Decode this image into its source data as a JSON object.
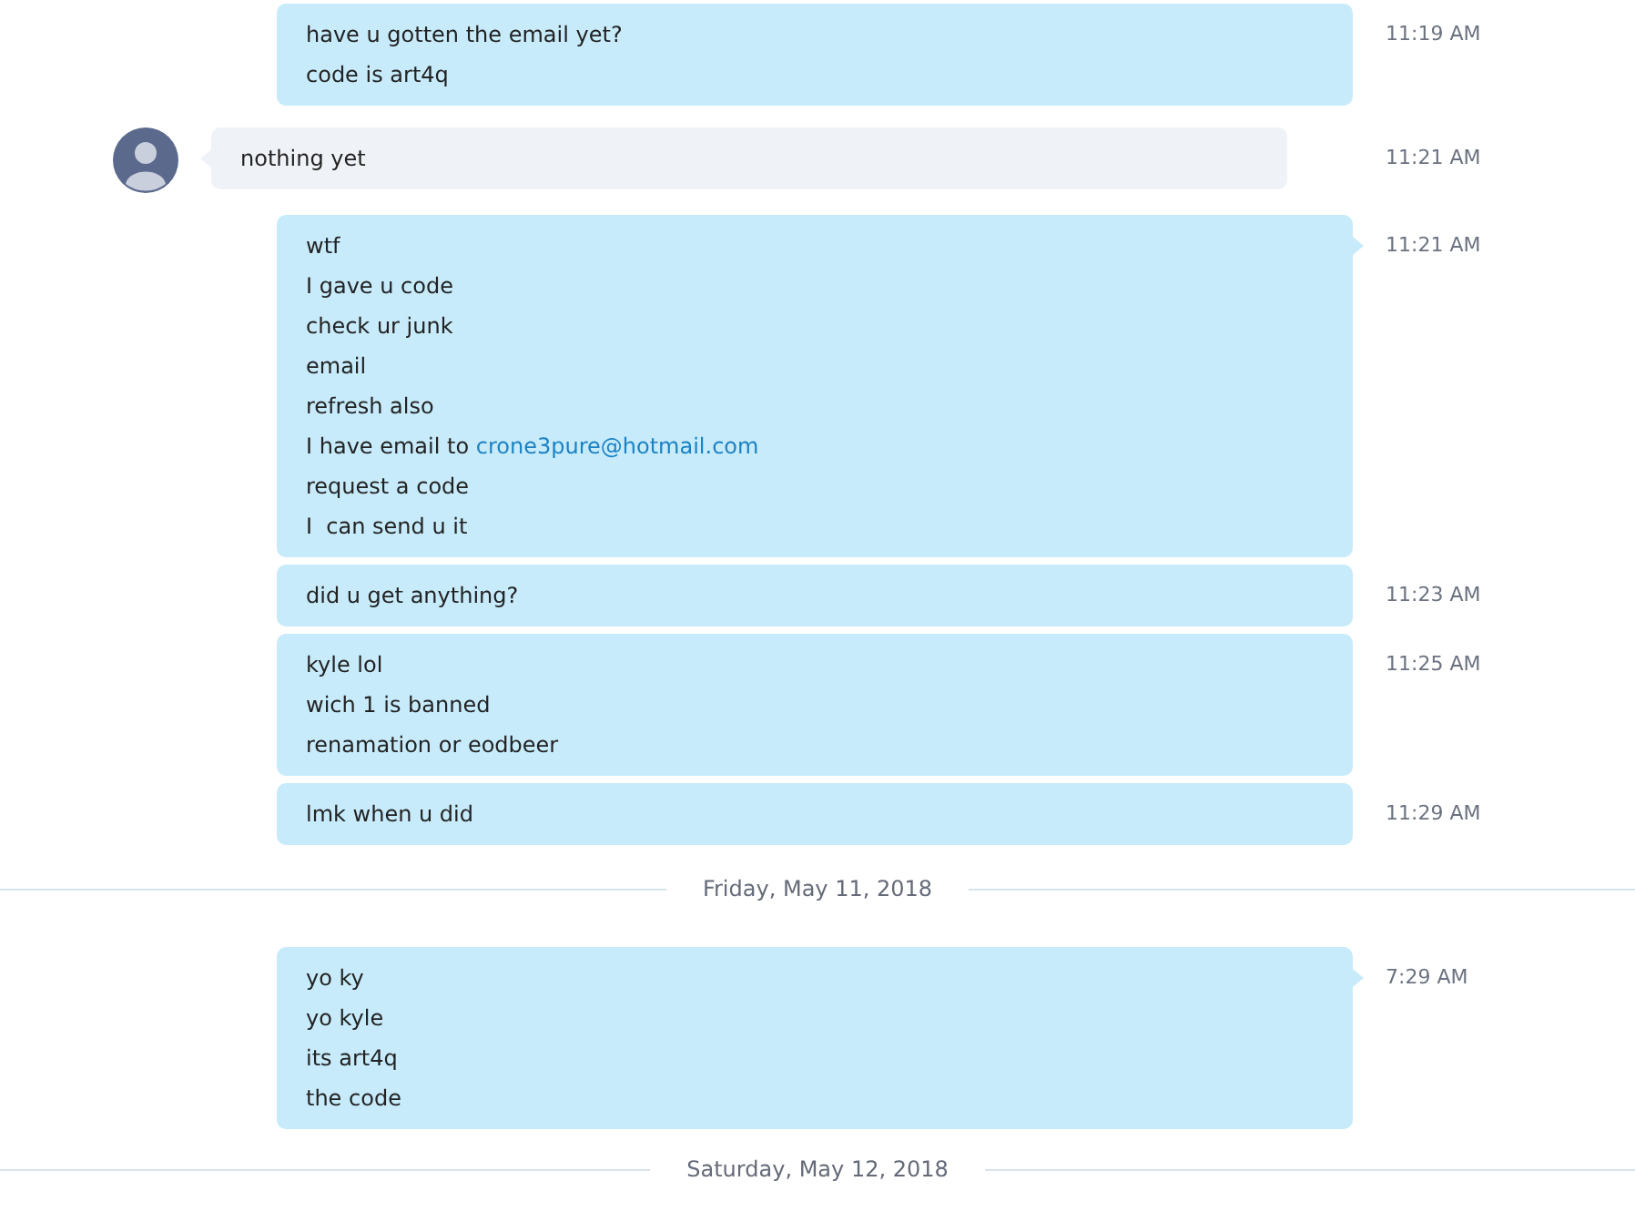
{
  "messages": [
    {
      "kind": "sent",
      "tail": false,
      "time": "11:19 AM",
      "lines": [
        {
          "text": "have u gotten the email yet?"
        },
        {
          "text": "code is art4q"
        }
      ]
    },
    {
      "kind": "received",
      "tail": true,
      "time": "11:21 AM",
      "lines": [
        {
          "text": "nothing yet"
        }
      ]
    },
    {
      "kind": "sent",
      "tail": true,
      "time": "11:21 AM",
      "lines": [
        {
          "text": "wtf"
        },
        {
          "text": "I gave u code"
        },
        {
          "text": "check ur junk"
        },
        {
          "text": "email"
        },
        {
          "text": "refresh also"
        },
        {
          "text": "I have email to ",
          "link": "crone3pure@hotmail.com"
        },
        {
          "text": "request a code"
        },
        {
          "text": "I  can send u it"
        }
      ]
    },
    {
      "kind": "sent",
      "tail": false,
      "time": "11:23 AM",
      "lines": [
        {
          "text": "did u get anything?"
        }
      ]
    },
    {
      "kind": "sent",
      "tail": false,
      "time": "11:25 AM",
      "lines": [
        {
          "text": "kyle lol"
        },
        {
          "text": "wich 1 is banned"
        },
        {
          "text": "renamation or eodbeer"
        }
      ]
    },
    {
      "kind": "sent",
      "tail": false,
      "time": "11:29 AM",
      "lines": [
        {
          "text": "lmk when u did"
        }
      ]
    },
    {
      "kind": "date",
      "text": "Friday, May 11, 2018"
    },
    {
      "kind": "sent",
      "tail": true,
      "time": "7:29 AM",
      "lines": [
        {
          "text": "yo ky"
        },
        {
          "text": "yo kyle"
        },
        {
          "text": "its art4q"
        },
        {
          "text": "the code"
        }
      ]
    },
    {
      "kind": "date",
      "text": "Saturday, May 12, 2018"
    }
  ]
}
